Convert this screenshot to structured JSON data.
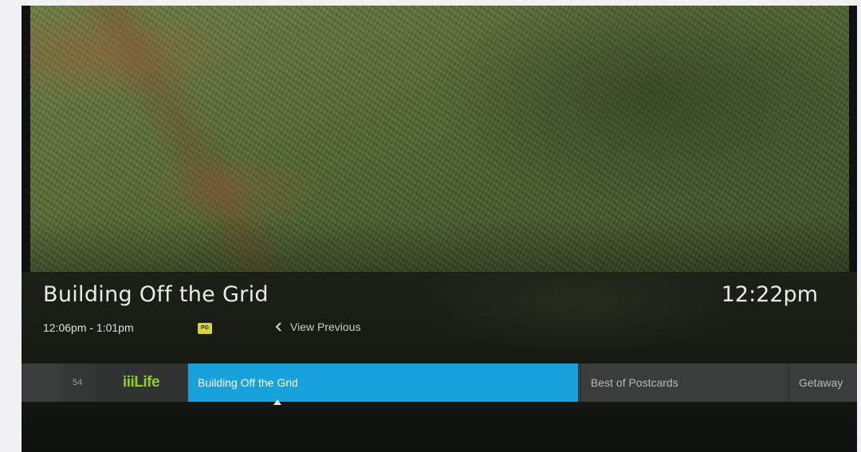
{
  "now_playing": {
    "title": "Building Off the Grid",
    "time_range": "12:06pm - 1:01pm",
    "rating_badge": "PG",
    "view_previous_label": "View Previous"
  },
  "clock": "12:22pm",
  "guide": {
    "channel_number": "54",
    "channel_logo_text": "iiiLife",
    "programs": [
      {
        "title": "Building Off the Grid",
        "selected": true
      },
      {
        "title": "Best of Postcards",
        "selected": false
      },
      {
        "title": "Getaway",
        "selected": false
      }
    ]
  },
  "colors": {
    "selected_program": "#18a2dc",
    "rating_badge": "#d7d33c",
    "channel_logo": "#8ccf2a"
  },
  "icons": {
    "view_previous": "chevron-left-icon",
    "selection_pointer": "triangle-up-icon"
  }
}
